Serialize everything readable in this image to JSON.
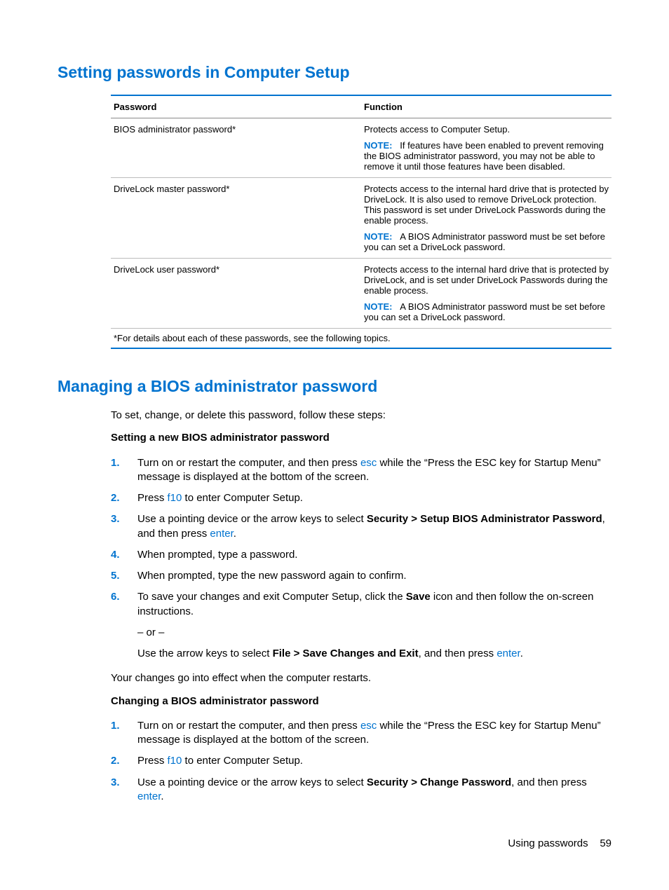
{
  "heading1": "Setting passwords in Computer Setup",
  "table": {
    "header": {
      "col1": "Password",
      "col2": "Function"
    },
    "rows": [
      {
        "col1": "BIOS administrator password*",
        "col2_p1": "Protects access to Computer Setup.",
        "note_label": "NOTE:",
        "note_text": "If features have been enabled to prevent removing the BIOS administrator password, you may not be able to remove it until those features have been disabled."
      },
      {
        "col1": "DriveLock master password*",
        "col2_p1": "Protects access to the internal hard drive that is protected by DriveLock. It is also used to remove DriveLock protection. This password is set under DriveLock Passwords during the enable process.",
        "note_label": "NOTE:",
        "note_text": "A BIOS Administrator password must be set before you can set a DriveLock password."
      },
      {
        "col1": "DriveLock user password*",
        "col2_p1": "Protects access to the internal hard drive that is protected by DriveLock, and is set under DriveLock Passwords during the enable process.",
        "note_label": "NOTE:",
        "note_text": "A BIOS Administrator password must be set before you can set a DriveLock password."
      }
    ],
    "footer": "*For details about each of these passwords, see the following topics."
  },
  "heading2": "Managing a BIOS administrator password",
  "intro": "To set, change, or delete this password, follow these steps:",
  "sub1": "Setting a new BIOS administrator password",
  "steps1": {
    "n1": "1.",
    "s1a": "Turn on or restart the computer, and then press ",
    "s1key": "esc",
    "s1b": " while the “Press the ESC key for Startup Menu” message is displayed at the bottom of the screen.",
    "n2": "2.",
    "s2a": "Press ",
    "s2key": "f10",
    "s2b": " to enter Computer Setup.",
    "n3": "3.",
    "s3a": "Use a pointing device or the arrow keys to select ",
    "s3bold": "Security > Setup BIOS Administrator Password",
    "s3b": ", and then press ",
    "s3key": "enter",
    "s3c": ".",
    "n4": "4.",
    "s4": "When prompted, type a password.",
    "n5": "5.",
    "s5": "When prompted, type the new password again to confirm.",
    "n6": "6.",
    "s6a": "To save your changes and exit Computer Setup, click the ",
    "s6bold1": "Save",
    "s6b": " icon and then follow the on-screen instructions.",
    "s6or": "– or –",
    "s6c": "Use the arrow keys to select ",
    "s6bold2": "File > Save Changes and Exit",
    "s6d": ", and then press ",
    "s6key": "enter",
    "s6e": "."
  },
  "after1": "Your changes go into effect when the computer restarts.",
  "sub2": "Changing a BIOS administrator password",
  "steps2": {
    "n1": "1.",
    "s1a": "Turn on or restart the computer, and then press ",
    "s1key": "esc",
    "s1b": " while the “Press the ESC key for Startup Menu” message is displayed at the bottom of the screen.",
    "n2": "2.",
    "s2a": "Press ",
    "s2key": "f10",
    "s2b": " to enter Computer Setup.",
    "n3": "3.",
    "s3a": "Use a pointing device or the arrow keys to select ",
    "s3bold": "Security > Change Password",
    "s3b": ", and then press ",
    "s3key": "enter",
    "s3c": "."
  },
  "footer_text": "Using passwords",
  "page_num": "59"
}
